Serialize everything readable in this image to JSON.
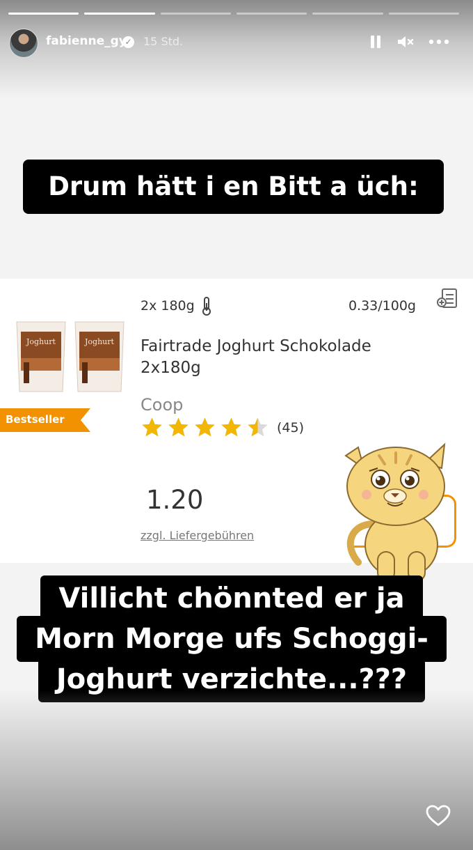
{
  "story": {
    "progress_segments": [
      1,
      1,
      0,
      0,
      0,
      0
    ],
    "user": {
      "username": "fabienne_gyr",
      "verified_icon": "verified-badge-icon",
      "time_ago": "15 Std."
    },
    "controls": {
      "pause_icon": "pause-icon",
      "mute_icon": "speaker-muted-icon",
      "more_icon": "more-horizontal-icon",
      "like_icon": "heart-outline-icon"
    },
    "caption_top": "Drum hätt i en Bitt a üch:",
    "caption_bottom_lines": [
      "Villicht chönnted er ja",
      "Morn Morge ufs Schoggi-",
      "Joghurt verzichte...???"
    ]
  },
  "product": {
    "quantity": "2x 180g",
    "unit_price": "0.33/100g",
    "name": "Fairtrade Joghurt Schokolade 2x180g",
    "brand": "Coop",
    "rating": 4.5,
    "rating_max": 5,
    "review_count": "(45)",
    "price": "1.20",
    "fee_note": "zzgl. Liefergebühren",
    "badge": "Bestseller",
    "image_label": "Joghurt",
    "colors": {
      "badge": "#f39200",
      "star": "#f2b705",
      "star_empty": "#d9d9d9"
    }
  }
}
